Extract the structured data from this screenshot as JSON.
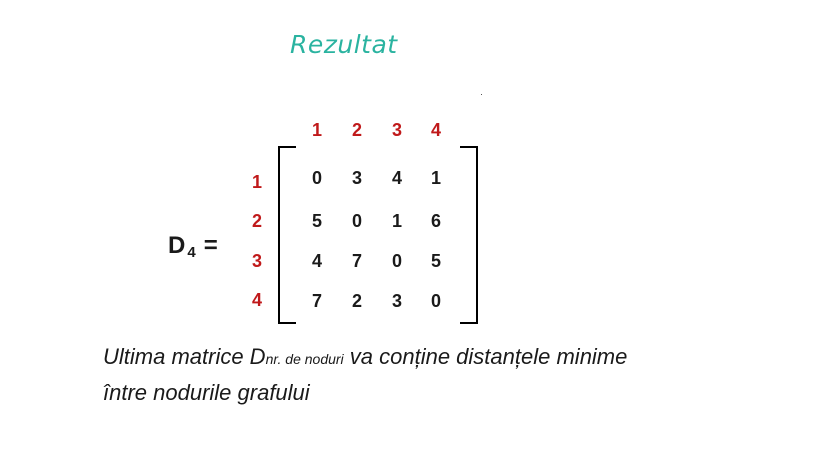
{
  "title": "Rezultat",
  "matrix": {
    "symbol": "D",
    "symbol_sub": "4",
    "equals": "=",
    "col_headers": [
      "1",
      "2",
      "3",
      "4"
    ],
    "row_headers": [
      "1",
      "2",
      "3",
      "4"
    ],
    "rows": [
      [
        "0",
        "3",
        "4",
        "1"
      ],
      [
        "5",
        "0",
        "1",
        "6"
      ],
      [
        "4",
        "7",
        "0",
        "5"
      ],
      [
        "7",
        "2",
        "3",
        "0"
      ]
    ]
  },
  "caption": {
    "part1": "Ultima matrice D",
    "part1_sub": "nr. de noduri",
    "part2": " va conține distanțele minime",
    "line2": "între nodurile grafului"
  },
  "colors": {
    "title": "#2ab3a0",
    "headers": "#c0191a",
    "text": "#1a1a1a"
  }
}
